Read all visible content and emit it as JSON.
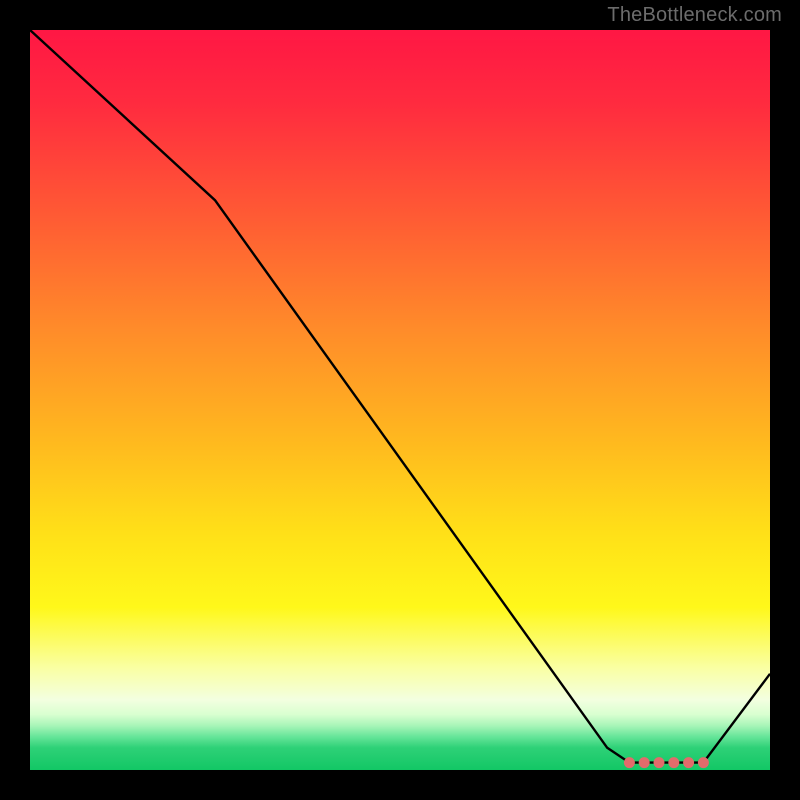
{
  "attribution": "TheBottleneck.com",
  "chart_data": {
    "type": "line",
    "title": "",
    "xlabel": "",
    "ylabel": "",
    "xlim": [
      0,
      100
    ],
    "ylim": [
      0,
      100
    ],
    "x": [
      0,
      25,
      78,
      81,
      83,
      85,
      87,
      89,
      91,
      100
    ],
    "values": [
      100,
      77,
      3,
      1,
      1,
      1,
      1,
      1,
      1,
      13
    ],
    "marker_points": [
      {
        "x": 81,
        "y": 1
      },
      {
        "x": 83,
        "y": 1
      },
      {
        "x": 85,
        "y": 1
      },
      {
        "x": 87,
        "y": 1
      },
      {
        "x": 89,
        "y": 1
      },
      {
        "x": 91,
        "y": 1
      }
    ],
    "gradient_stops": [
      {
        "offset": 0.0,
        "color": "#ff1744"
      },
      {
        "offset": 0.1,
        "color": "#ff2b3f"
      },
      {
        "offset": 0.25,
        "color": "#ff5a34"
      },
      {
        "offset": 0.4,
        "color": "#ff8a2a"
      },
      {
        "offset": 0.55,
        "color": "#ffb71f"
      },
      {
        "offset": 0.68,
        "color": "#ffe018"
      },
      {
        "offset": 0.78,
        "color": "#fff81a"
      },
      {
        "offset": 0.86,
        "color": "#faffa0"
      },
      {
        "offset": 0.905,
        "color": "#f3ffe0"
      },
      {
        "offset": 0.925,
        "color": "#d9ffd0"
      },
      {
        "offset": 0.94,
        "color": "#a8f5b8"
      },
      {
        "offset": 0.955,
        "color": "#66e599"
      },
      {
        "offset": 0.97,
        "color": "#2ed177"
      },
      {
        "offset": 1.0,
        "color": "#12c765"
      }
    ],
    "line_color": "#000000",
    "marker_color": "#e26b6b"
  }
}
